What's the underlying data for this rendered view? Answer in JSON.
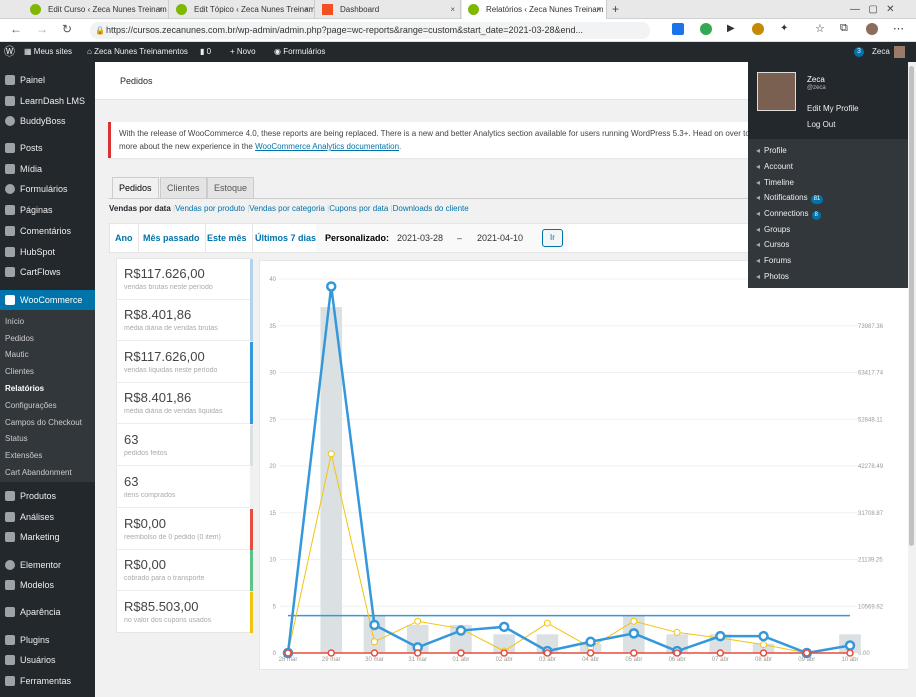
{
  "browser": {
    "tabs": [
      {
        "label": "Edit Curso ‹ Zeca Nunes Treinam"
      },
      {
        "label": "Edit Tópico ‹ Zeca Nunes Treinam"
      },
      {
        "label": "Dashboard"
      },
      {
        "label": "Relatórios ‹ Zeca Nunes Treinam"
      }
    ],
    "url": "https://cursos.zecanunes.com.br/wp-admin/admin.php?page=wc-reports&range=custom&start_date=2021-03-28&end..."
  },
  "adminbar": {
    "my_sites": "Meus sites",
    "site_name": "Zeca Nunes Treinamentos",
    "comments_count": "0",
    "new_label": "Novo",
    "forms_label": "Formulários",
    "notif_count": "3",
    "user_name": "Zeca"
  },
  "sidebar": {
    "items_top": [
      "Painel",
      "LearnDash LMS",
      "BuddyBoss",
      "Posts",
      "Mídia",
      "Formulários",
      "Páginas",
      "Comentários",
      "HubSpot",
      "CartFlows",
      "WooCommerce"
    ],
    "submenu": [
      "Início",
      "Pedidos",
      "Mautic",
      "Clientes",
      "Relatórios",
      "Configurações",
      "Campos do Checkout",
      "Status",
      "Extensões",
      "Cart Abandonment"
    ],
    "items_bottom": [
      "Produtos",
      "Análises",
      "Marketing",
      "Elementor",
      "Modelos",
      "Aparência",
      "Plugins",
      "Usuários",
      "Ferramentas"
    ]
  },
  "header": {
    "title": "Pedidos"
  },
  "notice": {
    "text": "With the release of WooCommerce 4.0, these reports are being replaced. There is a new and better Analytics section available for users running WordPress 5.3+. Head on over to t",
    "text2": "more about the new experience in the ",
    "link": "WooCommerce Analytics documentation",
    "text3": "."
  },
  "tabs": [
    "Pedidos",
    "Clientes",
    "Estoque"
  ],
  "subsub": {
    "current": "Vendas por data",
    "links": [
      "Vendas por produto",
      "Vendas por categoria",
      "Cupons por data",
      "Downloads do cliente"
    ]
  },
  "range": {
    "year": "Ano",
    "last_month": "Mês passado",
    "this_month": "Este mês",
    "last7": "Últimos 7 dias",
    "custom_label": "Personalizado:",
    "start": "2021-03-28",
    "dash": "–",
    "end": "2021-04-10",
    "go": "Ir"
  },
  "stats": [
    {
      "value": "R$117.626,00",
      "label": "vendas brutas neste período",
      "color": "#b1d4ea"
    },
    {
      "value": "R$8.401,86",
      "label": "média diária de vendas brutas",
      "color": "#b1d4ea"
    },
    {
      "value": "R$117.626,00",
      "label": "vendas líquidas neste período",
      "color": "#3498db"
    },
    {
      "value": "R$8.401,86",
      "label": "média diária de vendas líquidas",
      "color": "#3498db"
    },
    {
      "value": "63",
      "label": "pedidos feitos",
      "color": "#dbe1e3"
    },
    {
      "value": "63",
      "label": "itens comprados",
      "color": "#ecf0f1"
    },
    {
      "value": "R$0,00",
      "label": "reembolso de 0 pedido (0 item)",
      "color": "#e74c3c"
    },
    {
      "value": "R$0,00",
      "label": "cobrado para o transporte",
      "color": "#5cc488"
    },
    {
      "value": "R$85.503,00",
      "label": "no valor dos cupons usados",
      "color": "#f1c40f"
    }
  ],
  "chart_data": {
    "type": "bar",
    "categories": [
      "28 mar",
      "29 mar",
      "30 mar",
      "31 mar",
      "01 abr",
      "02 abr",
      "03 abr",
      "04 abr",
      "05 abr",
      "06 abr",
      "07 abr",
      "08 abr",
      "09 abr",
      "10 abr"
    ],
    "ylim": [
      0,
      40
    ],
    "y_ticks": [
      "0",
      "5",
      "10",
      "15",
      "20",
      "25",
      "30",
      "35",
      "40"
    ],
    "y2_ticks": [
      "0.00",
      "10569.62",
      "21139.25",
      "31708.87",
      "42278.49",
      "52848.11",
      "63417.74",
      "73987.36"
    ],
    "y2lim": [
      0,
      84557
    ],
    "series": [
      {
        "values": [
          0,
          37,
          4,
          3,
          3,
          2,
          2,
          1,
          4,
          2,
          2,
          1,
          0,
          2
        ],
        "color": "#dbe1e3"
      },
      {
        "values": [
          0,
          39.2,
          3,
          0.6,
          2.4,
          2.8,
          0.2,
          1.2,
          2.1,
          0.2,
          1.8,
          1.8,
          0,
          0.8
        ],
        "color": "#3498db"
      },
      {
        "values": [
          0,
          21.3,
          1.2,
          3.4,
          2.6,
          0.2,
          3.2,
          0.6,
          3.4,
          2.2,
          1.6,
          0.9,
          0,
          0
        ],
        "color": "#f1c40f"
      },
      {
        "values": [
          4,
          4,
          4,
          4,
          4,
          4,
          4,
          4,
          4,
          4,
          4,
          4,
          4,
          4
        ],
        "color": "#3498db"
      },
      {
        "values": [
          0,
          0,
          0,
          0,
          0,
          0,
          0,
          0,
          0,
          0,
          0,
          0,
          0,
          0
        ],
        "color": "#e74c3c"
      }
    ],
    "grid": true
  },
  "profile": {
    "name": "Zeca",
    "handle": "@zeca",
    "edit": "Edit My Profile",
    "logout": "Log Out",
    "menu": [
      {
        "label": "Profile"
      },
      {
        "label": "Account"
      },
      {
        "label": "Timeline"
      },
      {
        "label": "Notifications",
        "badge": "81"
      },
      {
        "label": "Connections",
        "badge": "8"
      },
      {
        "label": "Groups"
      },
      {
        "label": "Cursos"
      },
      {
        "label": "Forums"
      },
      {
        "label": "Photos"
      }
    ]
  }
}
